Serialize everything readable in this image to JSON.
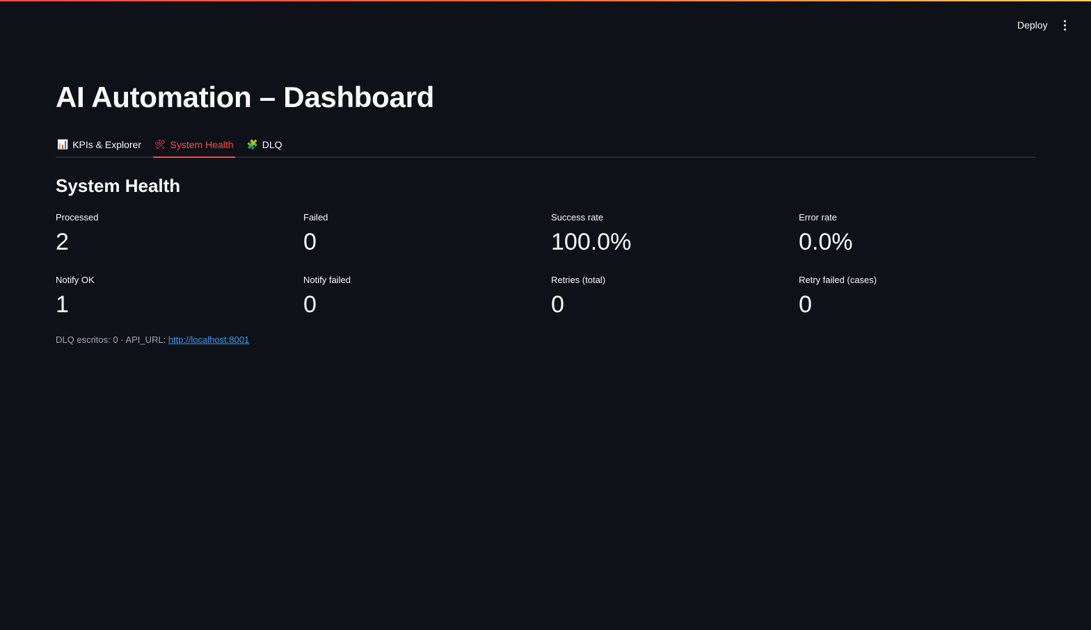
{
  "header": {
    "deploy_label": "Deploy",
    "menu_icon": "kebab-menu-icon"
  },
  "page": {
    "title": "AI Automation – Dashboard"
  },
  "tabs": [
    {
      "icon": "📊",
      "label": "KPIs & Explorer",
      "active": false
    },
    {
      "icon": "🛠",
      "label": "System Health",
      "active": true
    },
    {
      "icon": "🧩",
      "label": "DLQ",
      "active": false
    }
  ],
  "section": {
    "title": "System Health"
  },
  "metrics": [
    {
      "label": "Processed",
      "value": "2"
    },
    {
      "label": "Failed",
      "value": "0"
    },
    {
      "label": "Success rate",
      "value": "100.0%"
    },
    {
      "label": "Error rate",
      "value": "0.0%"
    },
    {
      "label": "Notify OK",
      "value": "1"
    },
    {
      "label": "Notify failed",
      "value": "0"
    },
    {
      "label": "Retries (total)",
      "value": "0"
    },
    {
      "label": "Retry failed (cases)",
      "value": "0"
    }
  ],
  "caption": {
    "prefix": "DLQ escritos: 0 · API_URL: ",
    "link_text": "http://localhost:8001"
  },
  "colors": {
    "background": "#0e1117",
    "accent": "#ff4b4b",
    "link": "#3d9df3",
    "muted": "#a3a8b8"
  }
}
